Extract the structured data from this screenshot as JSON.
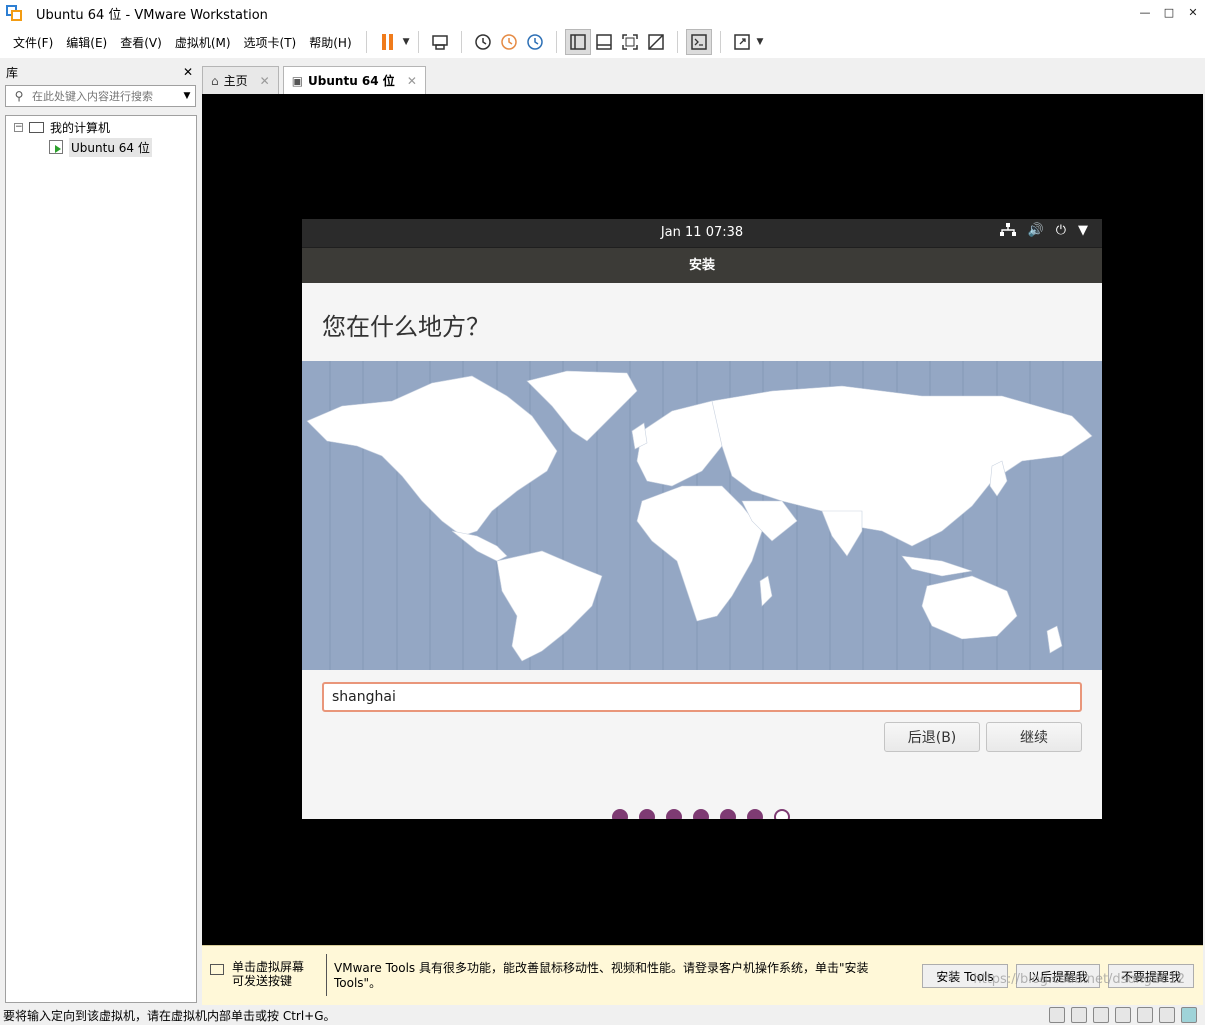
{
  "window": {
    "title": "Ubuntu 64 位 - VMware Workstation",
    "minimize": "—",
    "maximize": "□",
    "close": "✕"
  },
  "menu": {
    "items": [
      "文件(F)",
      "编辑(E)",
      "查看(V)",
      "虚拟机(M)",
      "选项卡(T)",
      "帮助(H)"
    ]
  },
  "library": {
    "title": "库",
    "close": "✕",
    "search_placeholder": "在此处键入内容进行搜索",
    "tree": {
      "root": "我的计算机",
      "child": "Ubuntu 64 位"
    }
  },
  "tabs": [
    {
      "label": "主页",
      "icon": "home-icon"
    },
    {
      "label": "Ubuntu 64 位",
      "icon": "vm-icon"
    }
  ],
  "tab_close": "✕",
  "guest": {
    "clock": "Jan 11  07:38",
    "header": "安装",
    "question": "您在什么地方？",
    "location_value": "shanghai",
    "back_button": "后退(B)",
    "continue_button": "继续",
    "progress": {
      "completed": 6,
      "total": 7
    },
    "accent": "#7e3b73"
  },
  "notice": {
    "hint": "单击虚拟屏幕\n可发送按键",
    "message": "VMware Tools 具有很多功能，能改善鼠标移动性、视频和性能。请登录客户机操作系统，单击\"安装 Tools\"。",
    "install": "安装 Tools",
    "later": "以后提醒我",
    "never": "不要提醒我"
  },
  "status": {
    "text": "要将输入定向到该虚拟机，请在虚拟机内部单击或按 Ctrl+G。",
    "watermark": "https://blog.csdn.net/dsong2012"
  }
}
